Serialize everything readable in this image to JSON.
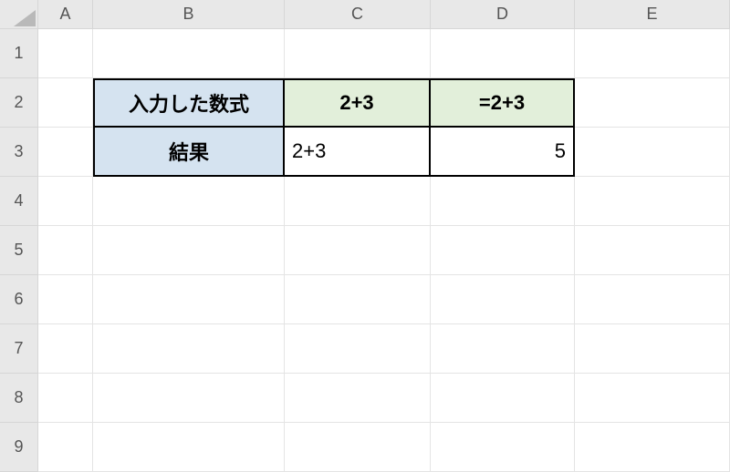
{
  "columns": [
    "A",
    "B",
    "C",
    "D",
    "E"
  ],
  "rows": [
    "1",
    "2",
    "3",
    "4",
    "5",
    "6",
    "7",
    "8",
    "9"
  ],
  "cells": {
    "B2": {
      "text": "入力した数式",
      "fill": "blue",
      "bold": true,
      "align": "center"
    },
    "C2": {
      "text": "2+3",
      "fill": "green",
      "bold": true,
      "align": "center"
    },
    "D2": {
      "text": "=2+3",
      "fill": "green",
      "bold": true,
      "align": "center"
    },
    "B3": {
      "text": "結果",
      "fill": "blue",
      "bold": true,
      "align": "center"
    },
    "C3": {
      "text": "2+3",
      "align": "left"
    },
    "D3": {
      "text": "5",
      "align": "right"
    }
  }
}
